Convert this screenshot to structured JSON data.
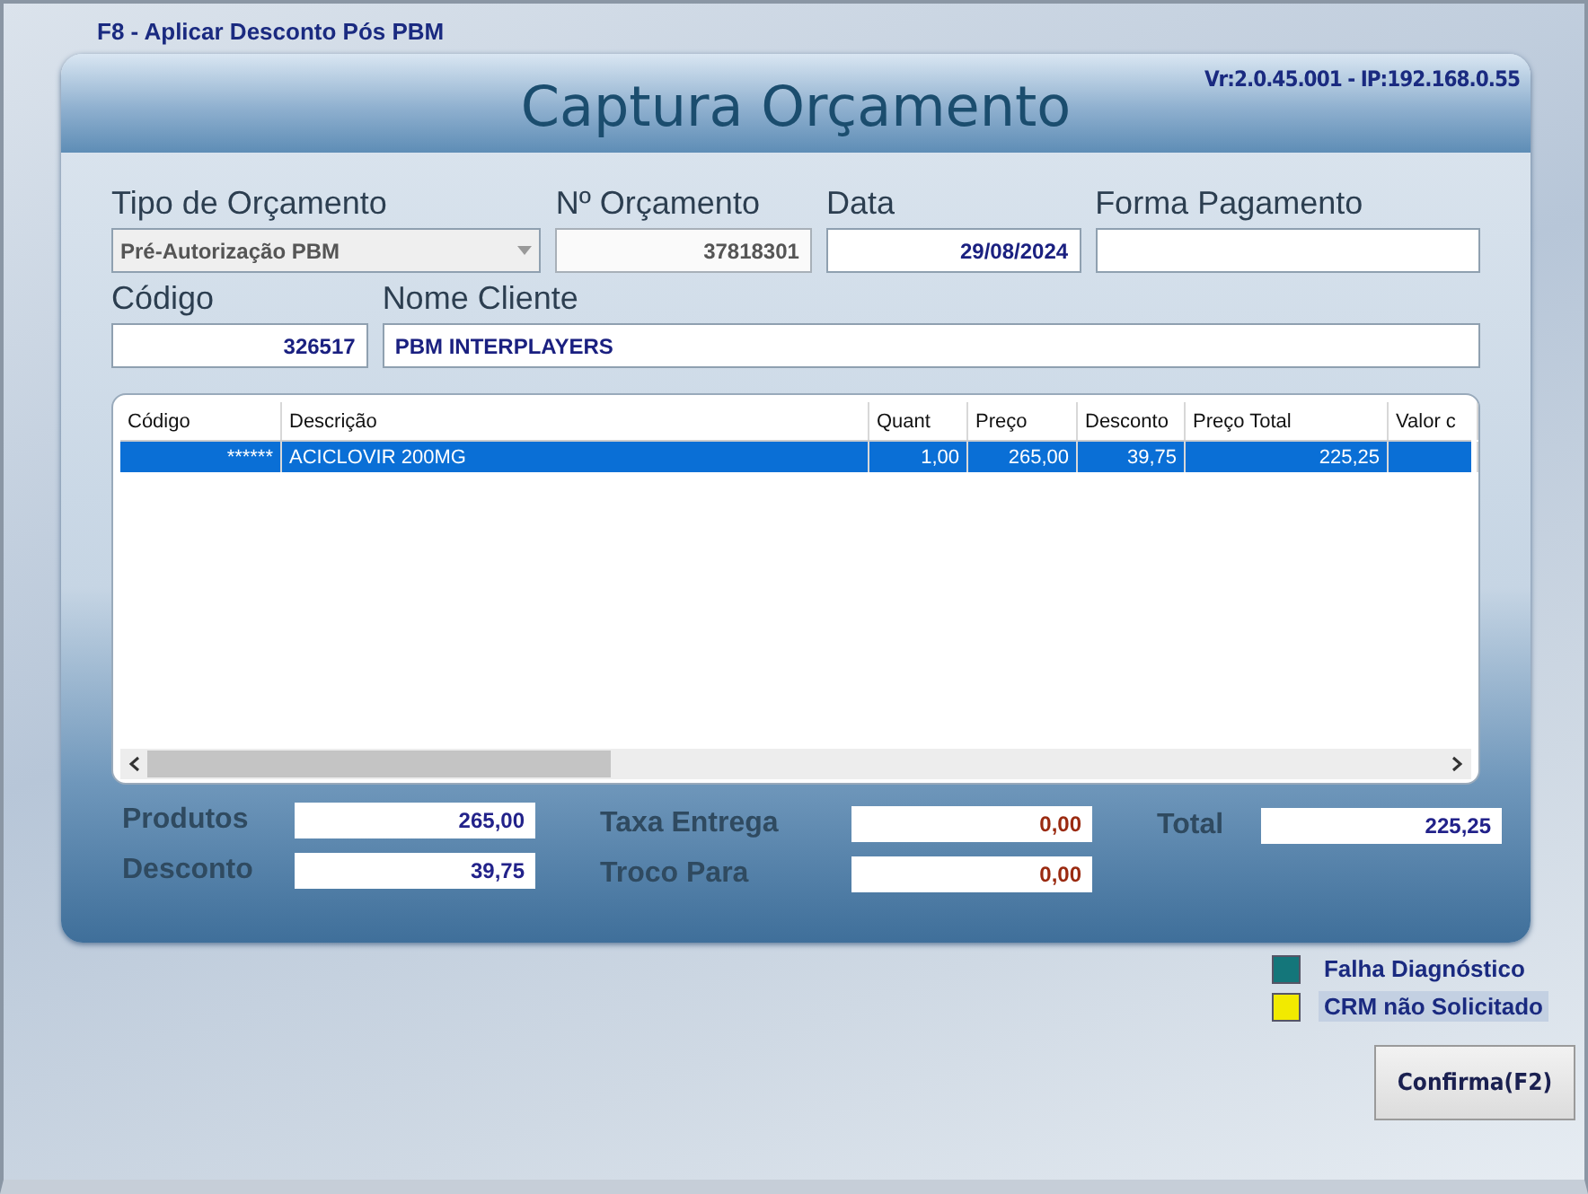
{
  "window": {
    "title": "F8 - Aplicar Desconto Pós PBM"
  },
  "header": {
    "title": "Captura Orçamento",
    "version": "Vr:2.0.45.001 - IP:192.168.0.55"
  },
  "fields_row1": [
    {
      "kind": "select",
      "label": "Tipo de Orçamento",
      "value": "Pré-Autorização PBM",
      "disabled": true
    },
    {
      "kind": "text",
      "label": "Nº Orçamento",
      "value": "37818301",
      "disabled": true
    },
    {
      "kind": "text",
      "label": "Data",
      "value": "29/08/2024",
      "disabled": false
    },
    {
      "kind": "text",
      "label": "Forma Pagamento",
      "disabled": false
    }
  ],
  "fields_row2": [
    {
      "kind": "text",
      "label": "Código",
      "value": "326517",
      "disabled": false
    },
    {
      "kind": "text",
      "label": "Nome Cliente",
      "value": "PBM INTERPLAYERS",
      "disabled": false
    }
  ],
  "table": {
    "columns": [
      "Código",
      "Descrição",
      "Quant",
      "Preço",
      "Desconto",
      "Preço Total",
      "Valor c"
    ],
    "rows": [
      {
        "cells": [
          "******",
          "ACICLOVIR 200MG",
          "1,00",
          "265,00",
          "39,75",
          "225,25",
          ""
        ],
        "selected": true
      }
    ]
  },
  "totals": [
    {
      "label": "Produtos",
      "value": "265,00",
      "color": "#22228a"
    },
    {
      "label": "Desconto",
      "value": "39,75",
      "color": "#22228a"
    },
    {
      "label": "Taxa Entrega",
      "value": "0,00",
      "color": "#9a2a10"
    },
    {
      "label": "Troco Para",
      "value": "0,00",
      "color": "#9a2a10"
    },
    {
      "label": "Total",
      "value": "225,25",
      "color": "#22228a"
    }
  ],
  "legend": [
    {
      "label": "Falha Diagnóstico",
      "color": "#14767a",
      "highlighted": false
    },
    {
      "label": "CRM não Solicitado",
      "color": "#f2ea00",
      "highlighted": true
    }
  ],
  "buttons": [
    "Confirma(F2)"
  ]
}
